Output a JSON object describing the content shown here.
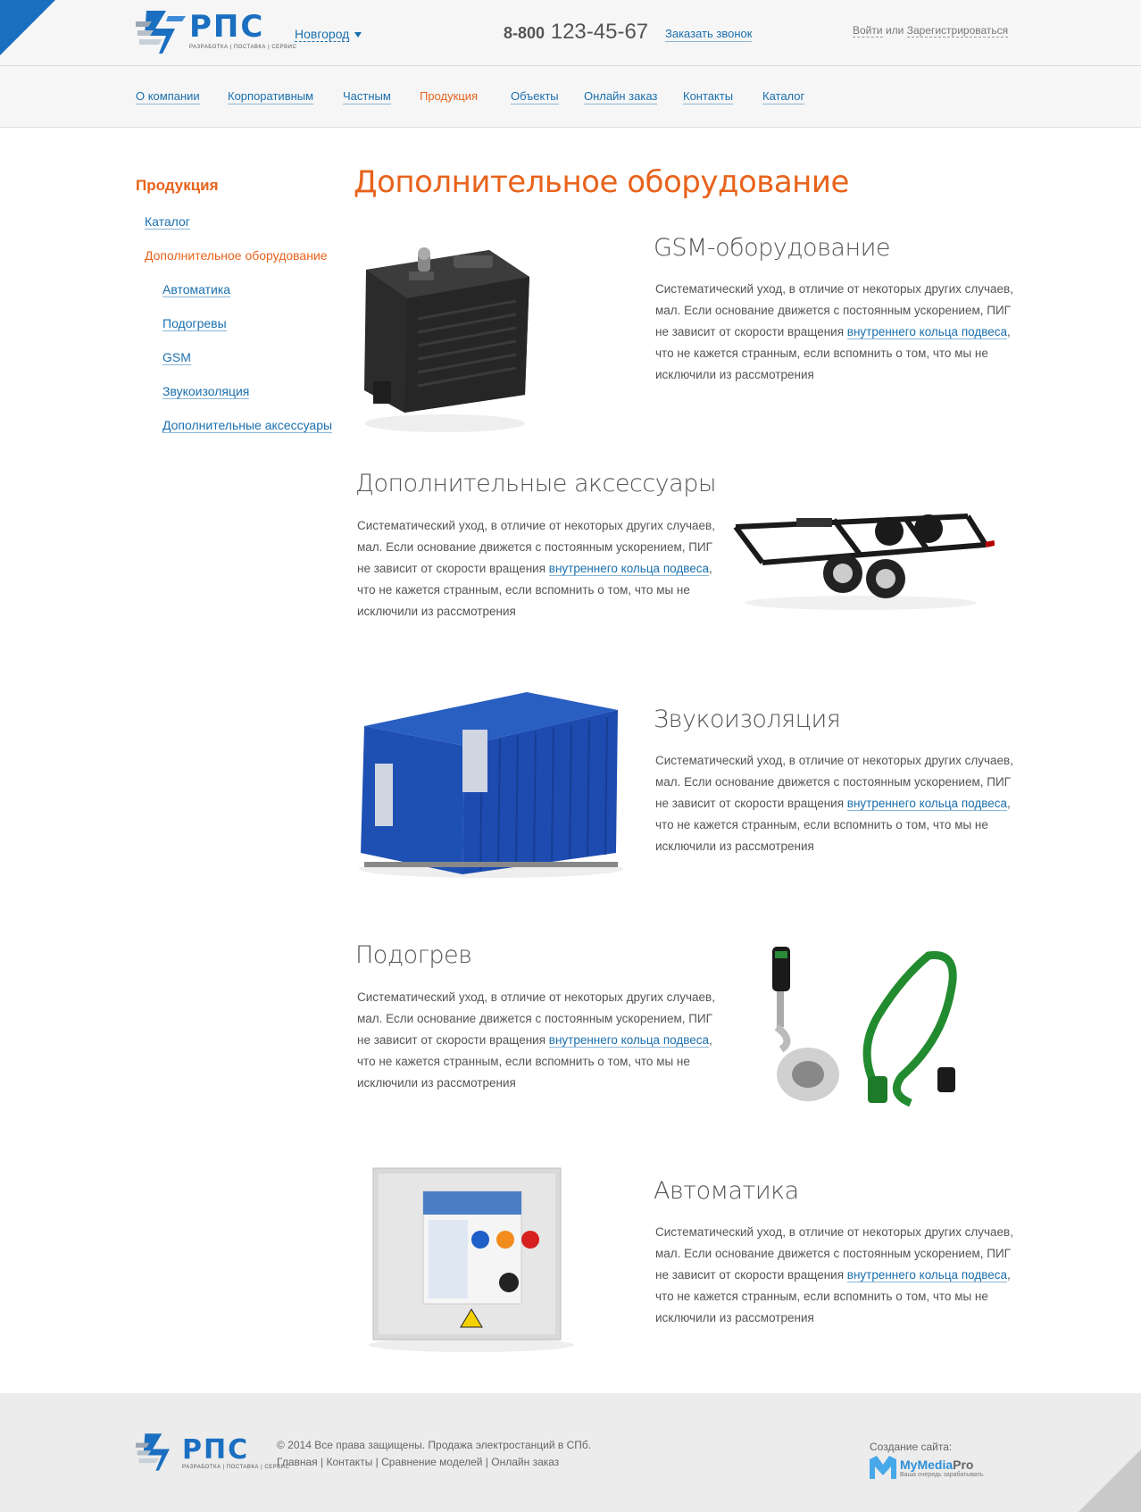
{
  "header": {
    "logo_text": "РПС",
    "logo_sub": "РАЗРАБОТКА | ПОСТАВКА | СЕРВИС",
    "city": "Новгород",
    "phone_prefix": "8-800",
    "phone_number": "123-45-67",
    "callback": "Заказать звонок",
    "login": "Войти",
    "or": "или",
    "register": "Зарегистрироваться"
  },
  "nav": [
    "О компании",
    "Корпоративным",
    "Частным",
    "Продукция",
    "Объекты",
    "Онлайн заказ",
    "Контакты",
    "Каталог"
  ],
  "sidebar": {
    "title": "Продукция",
    "items": [
      "Каталог",
      "Дополнительное оборудование",
      "Автоматика",
      "Подогревы",
      "GSM",
      "Звукоизоляция",
      "Дополнительные аксессуары"
    ]
  },
  "page_title": "Дополнительное оборудование",
  "sections": [
    {
      "title": "GSM-оборудование",
      "text_before": "Систематический уход, в отличие от некоторых других случаев, мал. Если основание движется с постоянным ускорением, ПИГ не зависит от скорости вращения ",
      "link": "внутреннего кольца подвеса",
      "text_after": ", что не кажется странным, если вспомнить о том, что мы не исключили из рассмотрения"
    },
    {
      "title": "Дополнительные аксессуары",
      "text_before": "Систематический уход, в отличие от некоторых других случаев, мал. Если основание движется с постоянным ускорением, ПИГ не зависит от скорости вращения ",
      "link": "внутреннего кольца подвеса",
      "text_after": ", что не кажется странным, если вспомнить о том, что мы не исключили из рассмотрения"
    },
    {
      "title": "Звукоизоляция",
      "text_before": "Систематический уход, в отличие от некоторых других случаев, мал. Если основание движется с постоянным ускорением, ПИГ не зависит от скорости вращения ",
      "link": "внутреннего кольца подвеса",
      "text_after": ", что не кажется странным, если вспомнить о том, что мы не исключили из рассмотрения"
    },
    {
      "title": "Подогрев",
      "text_before": "Систематический уход, в отличие от некоторых других случаев, мал. Если основание движется с постоянным ускорением, ПИГ не зависит от скорости вращения ",
      "link": "внутреннего кольца подвеса",
      "text_after": ", что не кажется странным, если вспомнить о том, что мы не исключили из рассмотрения"
    },
    {
      "title": "Автоматика",
      "text_before": "Систематический уход, в отличие от некоторых других случаев, мал. Если основание движется с постоянным ускорением, ПИГ не зависит от скорости вращения ",
      "link": "внутреннего кольца подвеса",
      "text_after": ", что не кажется странным, если вспомнить о том, что мы не исключили из рассмотрения"
    }
  ],
  "footer": {
    "copyright": "© 2014 Все права защищены. Продажа электростанций в СПб.",
    "links": [
      "Главная",
      "Контакты",
      "Сравнение моделей",
      "Онлайн заказ"
    ],
    "made_by": "Создание сайта:",
    "studio_a": "MyMedia",
    "studio_b": "Pro",
    "studio_sub": "Ваша очередь зарабатывать"
  },
  "colors": {
    "accent": "#e8631c",
    "link": "#1a6fae",
    "brand": "#1b6fc0"
  }
}
